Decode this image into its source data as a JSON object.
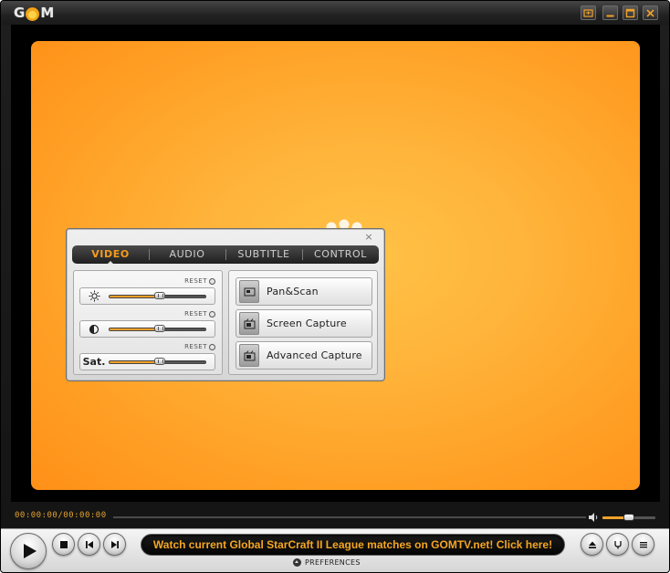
{
  "app": {
    "logo_text": "GOM",
    "window_buttons": [
      "restore-down-icon",
      "minimize-icon",
      "maximize-icon",
      "close-icon"
    ]
  },
  "control_panel": {
    "close_glyph": "×",
    "tabs": [
      {
        "label": "VIDEO",
        "active": true
      },
      {
        "label": "AUDIO",
        "active": false
      },
      {
        "label": "SUBTITLE",
        "active": false
      },
      {
        "label": "CONTROL",
        "active": false
      }
    ],
    "adjustments": [
      {
        "name": "brightness",
        "icon": "sun-icon",
        "label": "",
        "reset_label": "RESET",
        "level": 0.52
      },
      {
        "name": "contrast",
        "icon": "contrast-icon",
        "label": "",
        "reset_label": "RESET",
        "level": 0.52
      },
      {
        "name": "saturation",
        "icon": "",
        "label": "Sat.",
        "reset_label": "RESET",
        "level": 0.52
      }
    ],
    "actions": [
      {
        "label": "Pan&Scan",
        "icon": "pan-scan-icon"
      },
      {
        "label": "Screen Capture",
        "icon": "camera-icon"
      },
      {
        "label": "Advanced Capture",
        "icon": "camera-icon"
      }
    ]
  },
  "seek": {
    "time": "00:00:00/00:00:00",
    "position": 0.0
  },
  "volume": {
    "icon": "speaker-icon",
    "level": 0.5
  },
  "controls": {
    "ticker": "Watch current Global StarCraft II League matches on GOMTV.net! Click here!",
    "preferences_label": "PREFERENCES"
  },
  "colors": {
    "accent": "#f49b1c",
    "video_bg": "#ffa82e",
    "ticker_text": "#f5a623"
  }
}
